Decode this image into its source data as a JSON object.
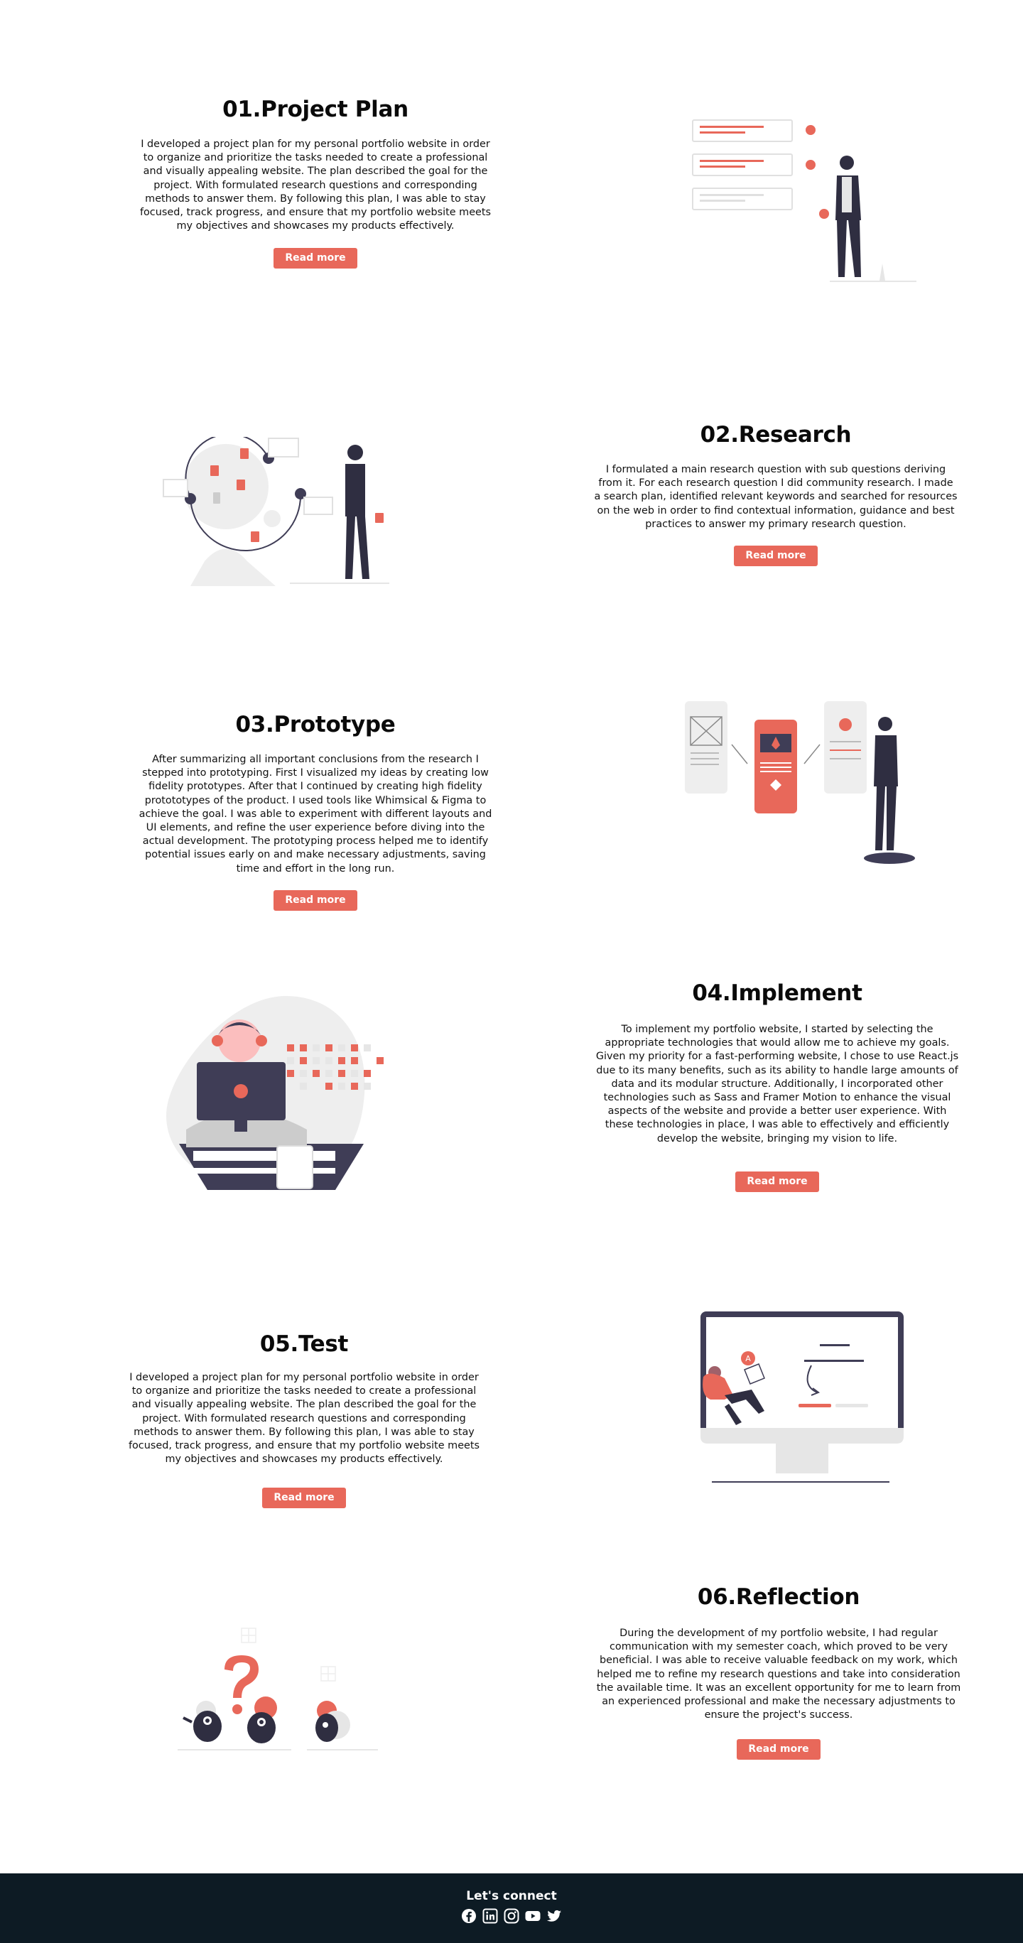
{
  "sections": [
    {
      "title": "01.Project Plan",
      "text": "I developed a project plan for my personal portfolio website in order to organize and prioritize the tasks needed to create a professional and visually appealing website. The plan described the goal for the project. With formulated research questions and corresponding methods to answer them. By following this plan, I was able to stay focused, track progress, and ensure that my portfolio website meets my objectives and showcases my products effectively.",
      "button": "Read more"
    },
    {
      "title": "02.Research",
      "text": "I formulated a main research question with sub questions deriving from it. For each research question I did community research. I made a search plan, identified relevant keywords and searched for resources on the web in order to find contextual information, guidance and best practices to answer my primary research question.",
      "button": "Read more"
    },
    {
      "title": "03.Prototype",
      "text": "After summarizing all important conclusions from the research I stepped into prototyping. First I visualized my ideas by creating low fidelity prototypes. After that I continued by creating high fidelity protototypes of the product. I used tools like Whimsical & Figma to achieve the goal. I was able to experiment with different layouts and UI elements, and refine the user experience before diving into the actual development. The prototyping process helped me to identify potential issues early on and make necessary adjustments, saving time and effort in the long run.",
      "button": "Read more"
    },
    {
      "title": "04.Implement",
      "text": "To implement my portfolio website, I started by selecting the appropriate technologies that would allow me to achieve my goals. Given my priority for a fast-performing website, I chose to use React.js due to its many benefits, such as its ability to handle large amounts of data and its modular structure. Additionally, I incorporated other technologies such as Sass and Framer Motion to enhance the visual aspects of the website and provide a better user experience. With these technologies in place, I was able to effectively and efficiently develop the website, bringing my vision to life.",
      "button": "Read more"
    },
    {
      "title": "05.Test",
      "text": "I developed a project plan for my personal portfolio website in order to organize and prioritize the tasks needed to create a professional and visually appealing website. The plan described the goal for the project. With formulated research questions and corresponding methods to answer them. By following this plan, I was able to stay focused, track progress, and ensure that my portfolio website meets my objectives and showcases my products effectively.",
      "button": "Read more"
    },
    {
      "title": "06.Reflection",
      "text": "During the development of my portfolio website, I had regular communication with my semester coach, which proved to be very beneficial. I was able to receive valuable feedback on my work, which helped me to refine my research questions and take into consideration the available time. It was an excellent opportunity for me to learn from an experienced professional and make the necessary adjustments to ensure the project's success.",
      "button": "Read more"
    }
  ],
  "footer": {
    "heading": "Let's connect",
    "social_icons": [
      "facebook-icon",
      "linkedin-icon",
      "instagram-icon",
      "youtube-icon",
      "twitter-icon"
    ]
  },
  "colors": {
    "accent": "#e8685a",
    "dark": "#3f3d56",
    "footer_bg": "#0d1b24"
  }
}
